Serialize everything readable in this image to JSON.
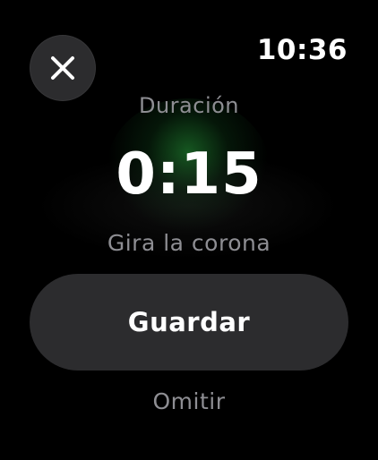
{
  "status_bar": {
    "time": "10:36"
  },
  "header": {
    "close_icon": "close-icon"
  },
  "duration": {
    "label": "Duración",
    "value": "0:15",
    "hint": "Gira la corona"
  },
  "actions": {
    "save_label": "Guardar",
    "skip_label": "Omitir"
  },
  "colors": {
    "background": "#000000",
    "button_bg": "#2c2c2e",
    "secondary_text": "#8e8e93",
    "accent_glow": "#28a03c"
  }
}
